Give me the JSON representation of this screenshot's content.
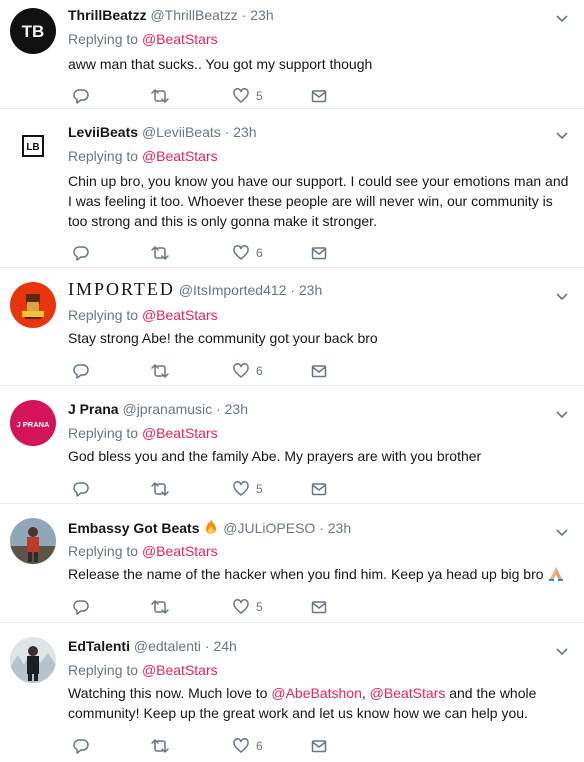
{
  "colors": {
    "accent": "#e0245e",
    "muted": "#657786",
    "text": "#14171a",
    "border": "#e6ecf0"
  },
  "tweets": [
    {
      "name": "ThrillBeatzz",
      "handle": "@ThrillBeatzz",
      "time": "23h",
      "replying_label": "Replying to",
      "replying_to": "@BeatStars",
      "text": "aww man that sucks.. You got my support though",
      "likes": "5",
      "avatar_icon": "tb-logo-icon"
    },
    {
      "name": "LeviiBeats",
      "handle": "@LeviiBeats",
      "time": "23h",
      "replying_label": "Replying to",
      "replying_to": "@BeatStars",
      "text": "Chin up bro, you know you have our support. I could see your emotions man and I was feeling it too. Whoever these people are will never win, our community is too strong and this is only gonna make it stronger.",
      "likes": "6",
      "avatar_icon": "lb-logo-icon"
    },
    {
      "name": "IMPORTED",
      "handle": "@ItsImported412",
      "time": "23h",
      "replying_label": "Replying to",
      "replying_to": "@BeatStars",
      "text": "Stay strong Abe! the community got your back bro",
      "likes": "6",
      "avatar_icon": "imported-logo-icon"
    },
    {
      "name": "J Prana",
      "handle": "@jpranamusic",
      "time": "23h",
      "replying_label": "Replying to",
      "replying_to": "@BeatStars",
      "text": "God bless you and the family Abe. My prayers are with you brother",
      "likes": "5",
      "avatar_label": "J PRANA",
      "avatar_icon": "jprana-logo-icon"
    },
    {
      "name": "Embassy Got Beats",
      "handle": "@JULiOPESO",
      "time": "23h",
      "replying_label": "Replying to",
      "replying_to": "@BeatStars",
      "text": "Release the name of the hacker when you find him. Keep ya head up big bro",
      "likes": "5",
      "avatar_icon": "person-photo-icon"
    },
    {
      "name": "EdTalenti",
      "handle": "@edtalenti",
      "time": "24h",
      "replying_label": "Replying to",
      "replying_to": "@BeatStars",
      "text_prefix": "Watching this now. Much love to ",
      "mention_1": "@AbeBatshon",
      "separator": ", ",
      "mention_2": "@BeatStars",
      "text_suffix": " and the whole community! Keep up the great work and let us know how we can help you.",
      "likes": "6",
      "avatar_icon": "person-snow-photo-icon"
    }
  ]
}
